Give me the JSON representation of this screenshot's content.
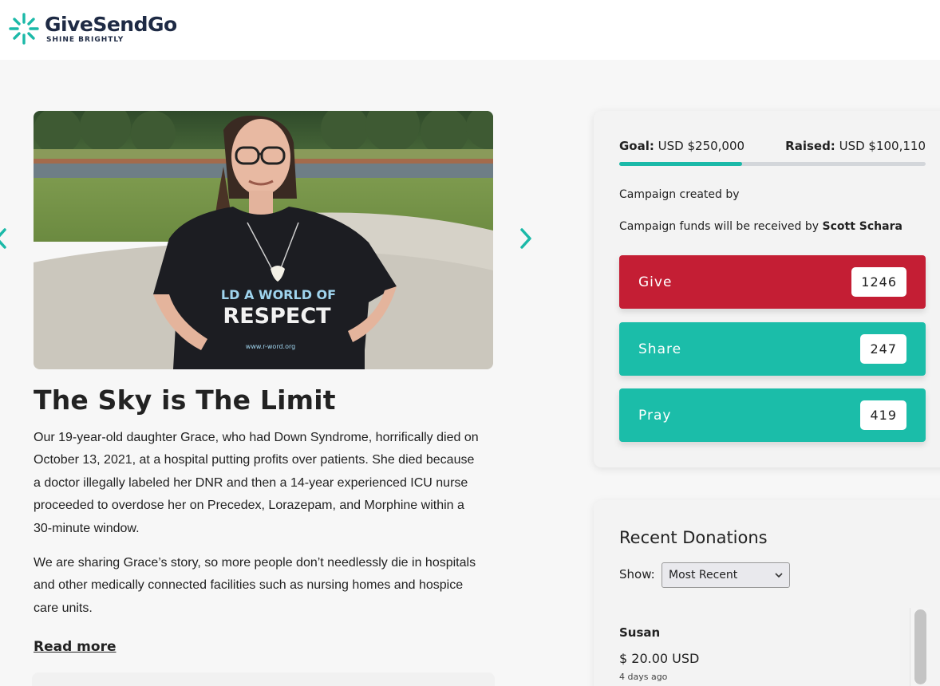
{
  "brand": {
    "name": "GiveSendGo",
    "tagline": "SHINE BRIGHTLY",
    "accent": "#1bb9a8",
    "navy": "#1e2a44"
  },
  "campaign": {
    "title": "The Sky is The Limit",
    "paragraphs": [
      "Our 19-year-old daughter Grace, who had Down Syndrome, horrifically died on October 13, 2021, at a hospital putting profits over patients. She died because a doctor illegally labeled her DNR and then a 14-year experienced ICU nurse proceeded to overdose her on Precedex, Lorazepam, and Morphine within a 30-minute window.",
      "We are sharing Grace’s story, so more people don’t needlessly die in hospitals and other medically connected facilities such as nursing homes and hospice care units."
    ],
    "read_more": "Read more",
    "shirt_text_line1": "LD A WORLD OF",
    "shirt_text_line2": "RESPECT",
    "shirt_url": "www.r-word.org"
  },
  "funding": {
    "goal_label": "Goal:",
    "goal_value": "USD $250,000",
    "raised_label": "Raised:",
    "raised_value": "USD $100,110",
    "progress_fraction": 0.4,
    "created_by": "Campaign created by",
    "funds_text": "Campaign funds will be received by",
    "recipient": "Scott Schara"
  },
  "actions": [
    {
      "label": "Give",
      "count": "1246",
      "color": "#c41e34"
    },
    {
      "label": "Share",
      "count": "247",
      "color": "#1bbda9"
    },
    {
      "label": "Pray",
      "count": "419",
      "color": "#1bbda9"
    }
  ],
  "donations": {
    "title": "Recent Donations",
    "show_label": "Show:",
    "sort_selected": "Most Recent",
    "items": [
      {
        "name": "Susan",
        "amount": "$ 20.00 USD",
        "ago": "4 days ago"
      }
    ]
  }
}
